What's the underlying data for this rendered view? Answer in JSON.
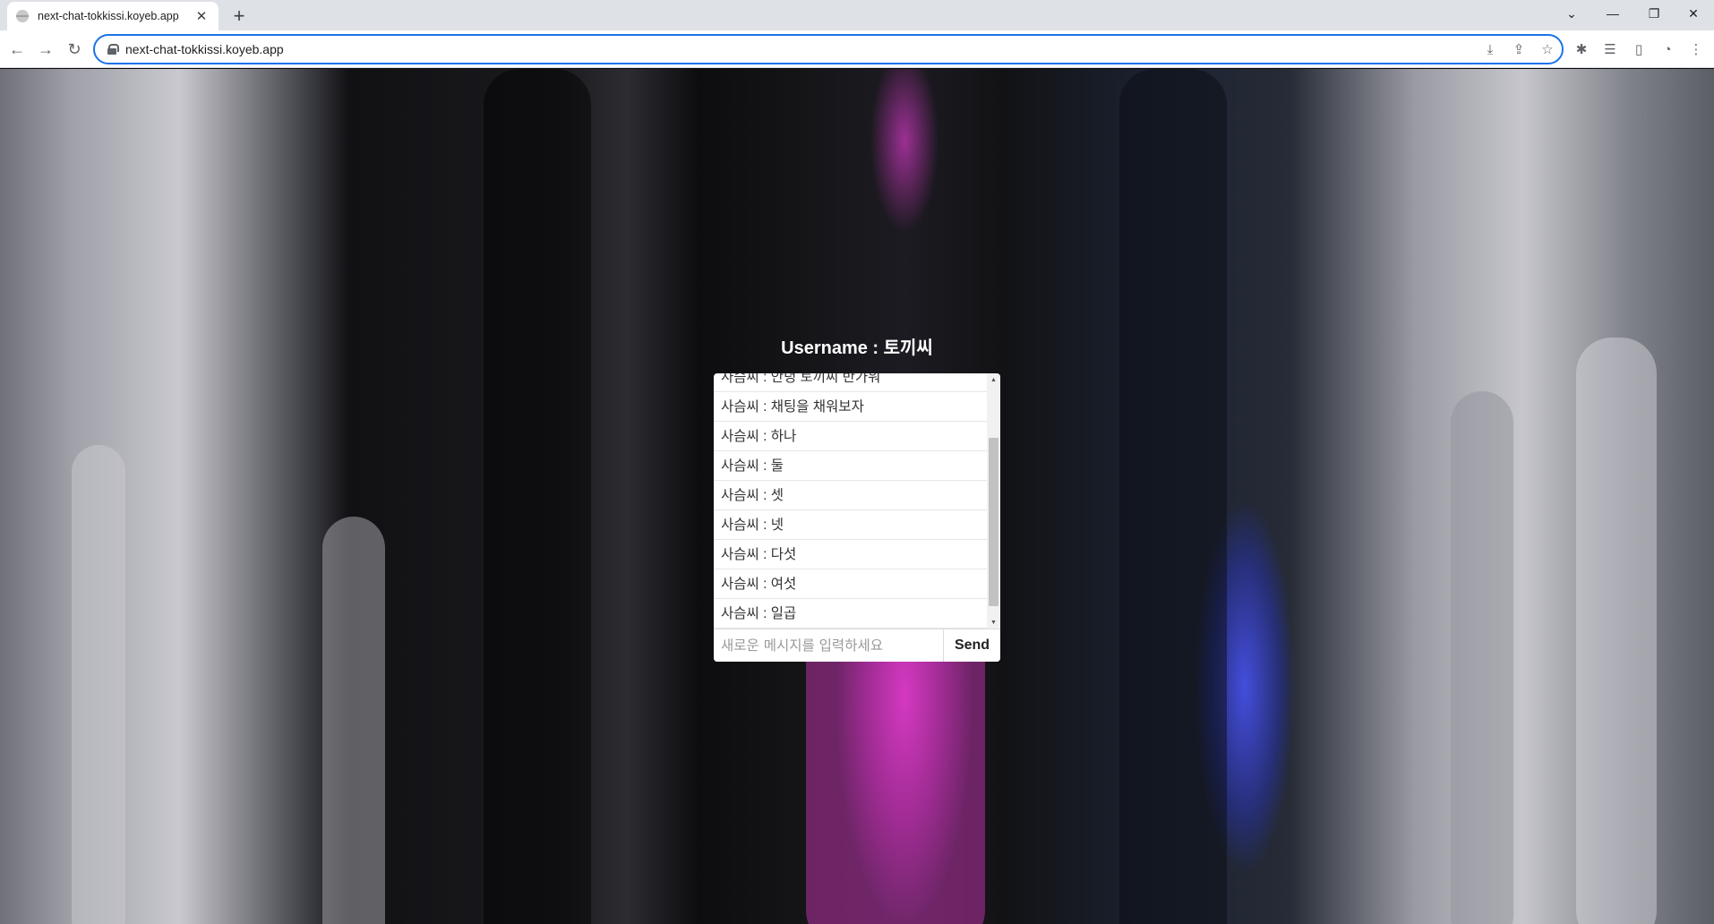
{
  "browser": {
    "tab_title": "next-chat-tokkissi.koyeb.app",
    "tab_close_glyph": "✕",
    "new_tab_glyph": "+",
    "url": "next-chat-tokkissi.koyeb.app",
    "window_controls": {
      "tab_search": "⌄",
      "minimize": "—",
      "restore": "❐",
      "close": "✕"
    },
    "nav": {
      "back": "←",
      "forward": "→",
      "reload": "↻"
    },
    "omnibox_icons": {
      "install": "⤓",
      "share": "⇪",
      "bookmark": "☆"
    },
    "toolbar_icons": {
      "extensions": "✱",
      "reading_list": "☰",
      "side_panel": "▯",
      "profile": "◔",
      "menu": "⋮"
    }
  },
  "chat": {
    "username_label": "Username : 토끼씨",
    "messages": [
      "사슴씨 : 안녕 토끼씨 반가워",
      "사슴씨 : 채팅을 채워보자",
      "사슴씨 : 하나",
      "사슴씨 : 둘",
      "사슴씨 : 셋",
      "사슴씨 : 넷",
      "사슴씨 : 다섯",
      "사슴씨 : 여섯",
      "사슴씨 : 일곱"
    ],
    "input_placeholder": "새로운 메시지를 입력하세요",
    "input_value": "",
    "send_label": "Send",
    "scroll_up_glyph": "▲",
    "scroll_down_glyph": "▼"
  },
  "colors": {
    "focus_ring": "#1a73e8",
    "accent_magenta": "#dc3cc8",
    "accent_blue": "#4650e6"
  }
}
